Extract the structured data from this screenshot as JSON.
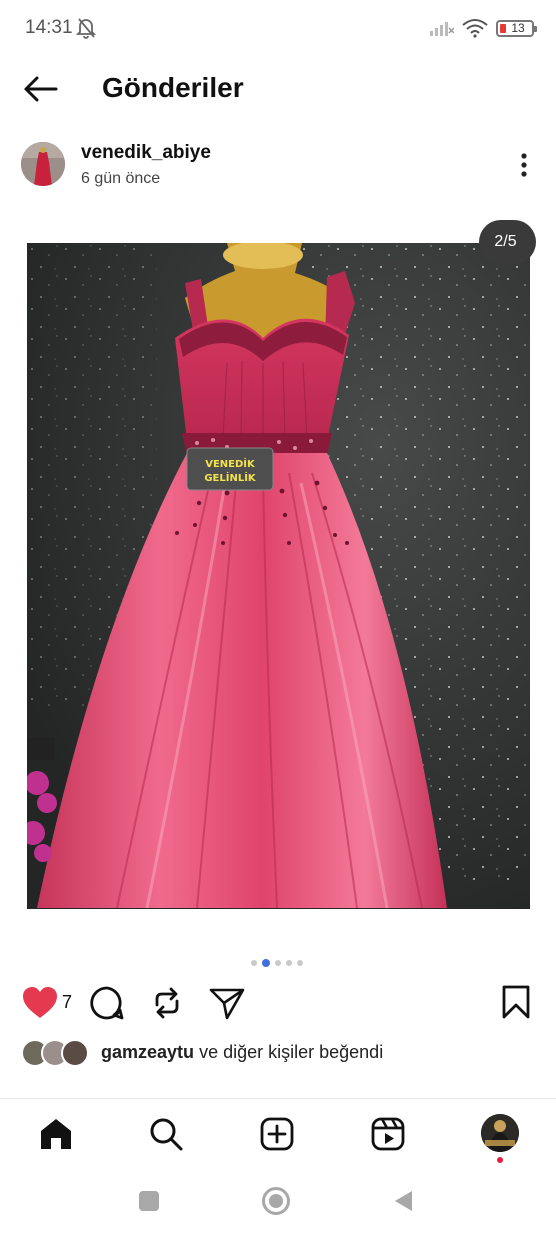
{
  "status_bar": {
    "time": "14:31",
    "battery": "13"
  },
  "header": {
    "title": "Gönderiler"
  },
  "post": {
    "username": "venedik_abiye",
    "time_ago": "6 gün önce",
    "counter": "2/5",
    "image_label": "VENEDİK GELİNLİK",
    "carousel_dots": 5,
    "active_dot": 1,
    "like_count": "7",
    "liked_by_user": "gamzeaytu",
    "liked_by_connector": "ve",
    "liked_by_rest": "diğer kişiler beğendi"
  },
  "colors": {
    "accent_blue": "#3d6fe0",
    "like_red": "#e53950",
    "dress_pink": "#e0446c"
  },
  "icons": {
    "back": "arrow-left-icon",
    "more": "more-vertical-icon",
    "like": "heart-filled-icon",
    "comment": "comment-icon",
    "repost": "repost-icon",
    "share": "send-icon",
    "bookmark": "bookmark-icon",
    "nav_home": "home-icon",
    "nav_search": "search-icon",
    "nav_create": "add-square-icon",
    "nav_reels": "reels-icon"
  }
}
